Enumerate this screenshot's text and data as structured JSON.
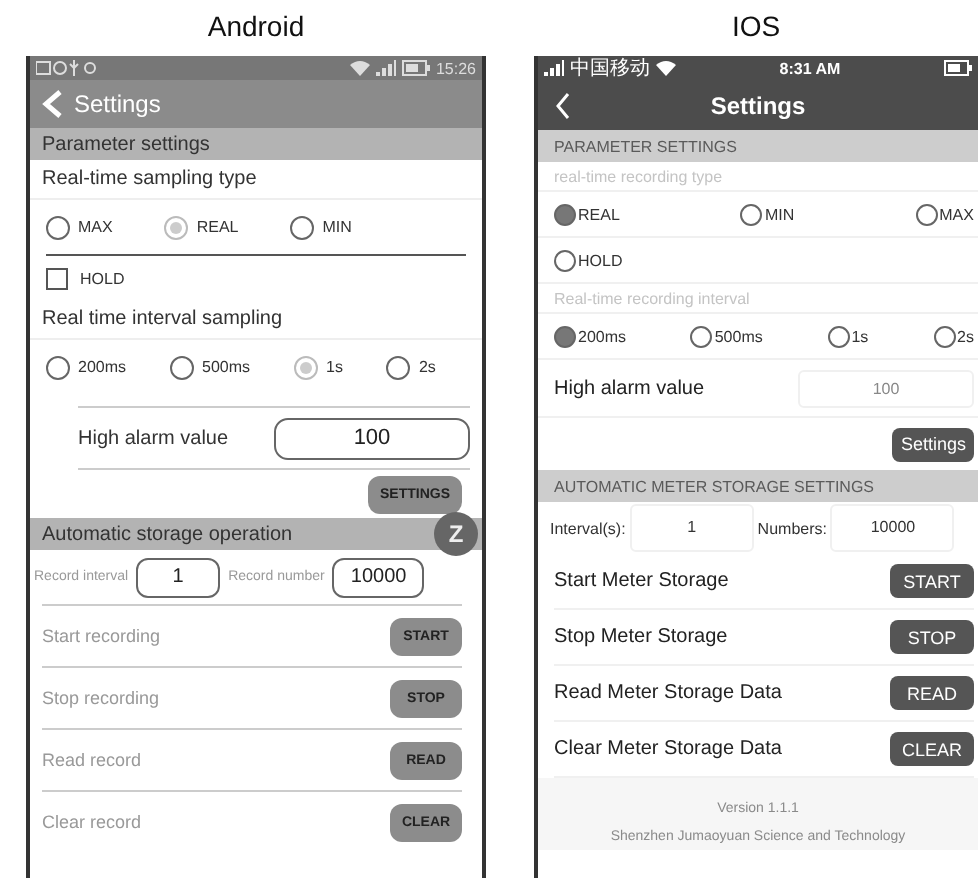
{
  "phones": [
    {
      "kind": "android",
      "caption": "Android",
      "status_bar": {
        "time": "15:26"
      },
      "header": {
        "title": "Settings"
      },
      "rows": [
        {
          "kind": "section",
          "text": "Parameter settings"
        },
        {
          "kind": "label",
          "text": "Real-time sampling type"
        },
        {
          "kind": "radios",
          "options": [
            {
              "label": "MAX",
              "selected": false
            },
            {
              "label": "REAL",
              "selected": true
            },
            {
              "label": "MIN",
              "selected": false
            }
          ]
        },
        {
          "kind": "checkbox",
          "label": "HOLD",
          "checked": false
        },
        {
          "kind": "label",
          "text": "Real time interval sampling"
        },
        {
          "kind": "radios",
          "options": [
            {
              "label": "200ms",
              "selected": false
            },
            {
              "label": "500ms",
              "selected": false
            },
            {
              "label": "1s",
              "selected": true
            },
            {
              "label": "2s",
              "selected": false
            }
          ]
        },
        {
          "kind": "field",
          "label": "High alarm value",
          "value": "100"
        },
        {
          "kind": "button",
          "text": "SETTINGS"
        },
        {
          "kind": "section",
          "text": "Automatic storage operation",
          "badge": "Z"
        },
        {
          "kind": "pair",
          "fields": [
            {
              "label": "Record interval",
              "value": "1"
            },
            {
              "label": "Record number",
              "value": "10000"
            }
          ]
        },
        {
          "kind": "action",
          "label": "Start recording",
          "button": "START"
        },
        {
          "kind": "action",
          "label": "Stop recording",
          "button": "STOP"
        },
        {
          "kind": "action",
          "label": "Read record",
          "button": "READ"
        },
        {
          "kind": "action",
          "label": "Clear record",
          "button": "CLEAR"
        }
      ]
    },
    {
      "kind": "ios",
      "caption": "IOS",
      "status_bar": {
        "carrier": "中国移动",
        "time": "8:31 AM"
      },
      "header": {
        "title": "Settings"
      },
      "rows": [
        {
          "kind": "section",
          "text": "PARAMETER SETTINGS"
        },
        {
          "kind": "label",
          "text": "real-time recording type"
        },
        {
          "kind": "radios",
          "options": [
            {
              "label": "REAL",
              "selected": true
            },
            {
              "label": "MIN",
              "selected": false
            },
            {
              "label": "MAX",
              "selected": false
            }
          ]
        },
        {
          "kind": "checkbox",
          "label": "HOLD",
          "checked": false
        },
        {
          "kind": "label",
          "text": "Real-time recording interval"
        },
        {
          "kind": "radios",
          "options": [
            {
              "label": "200ms",
              "selected": true
            },
            {
              "label": "500ms",
              "selected": false
            },
            {
              "label": "1s",
              "selected": false
            },
            {
              "label": "2s",
              "selected": false
            }
          ]
        },
        {
          "kind": "field",
          "label": "High alarm value",
          "value": "100"
        },
        {
          "kind": "button",
          "text": "Settings"
        },
        {
          "kind": "section",
          "text": "AUTOMATIC METER STORAGE SETTINGS"
        },
        {
          "kind": "pair",
          "fields": [
            {
              "label": "Interval(s):",
              "value": "1"
            },
            {
              "label": "Numbers:",
              "value": "10000"
            }
          ]
        },
        {
          "kind": "action",
          "label": "Start Meter Storage",
          "button": "START"
        },
        {
          "kind": "action",
          "label": "Stop Meter Storage",
          "button": "STOP"
        },
        {
          "kind": "action",
          "label": "Read Meter Storage Data",
          "button": "READ"
        },
        {
          "kind": "action",
          "label": "Clear Meter Storage Data",
          "button": "CLEAR"
        },
        {
          "kind": "footer",
          "text": "Version 1.1.1"
        },
        {
          "kind": "footer",
          "text": "Shenzhen Jumaoyuan Science and Technology"
        }
      ]
    }
  ]
}
